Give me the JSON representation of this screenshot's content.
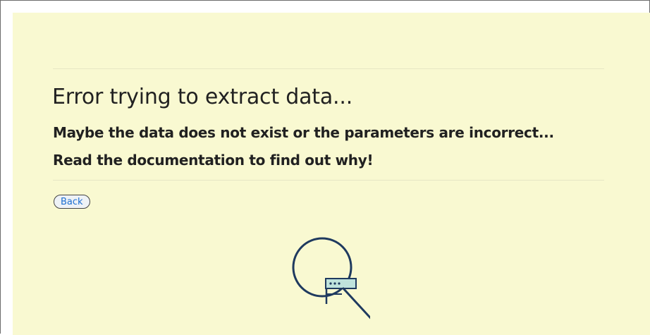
{
  "error": {
    "title": "Error trying to extract data...",
    "message_line1": "Maybe the data does not exist or the parameters are incorrect...",
    "message_line2": "Read the documentation to find out why!"
  },
  "actions": {
    "back_label": "Back"
  },
  "illustration": {
    "icon": "magnifier-search-icon",
    "stroke_color": "#1f3a5f",
    "accent_color": "#bfe3dc"
  },
  "colors": {
    "background": "#f9f9d1",
    "text": "#212121",
    "link": "#1d6fd1"
  }
}
